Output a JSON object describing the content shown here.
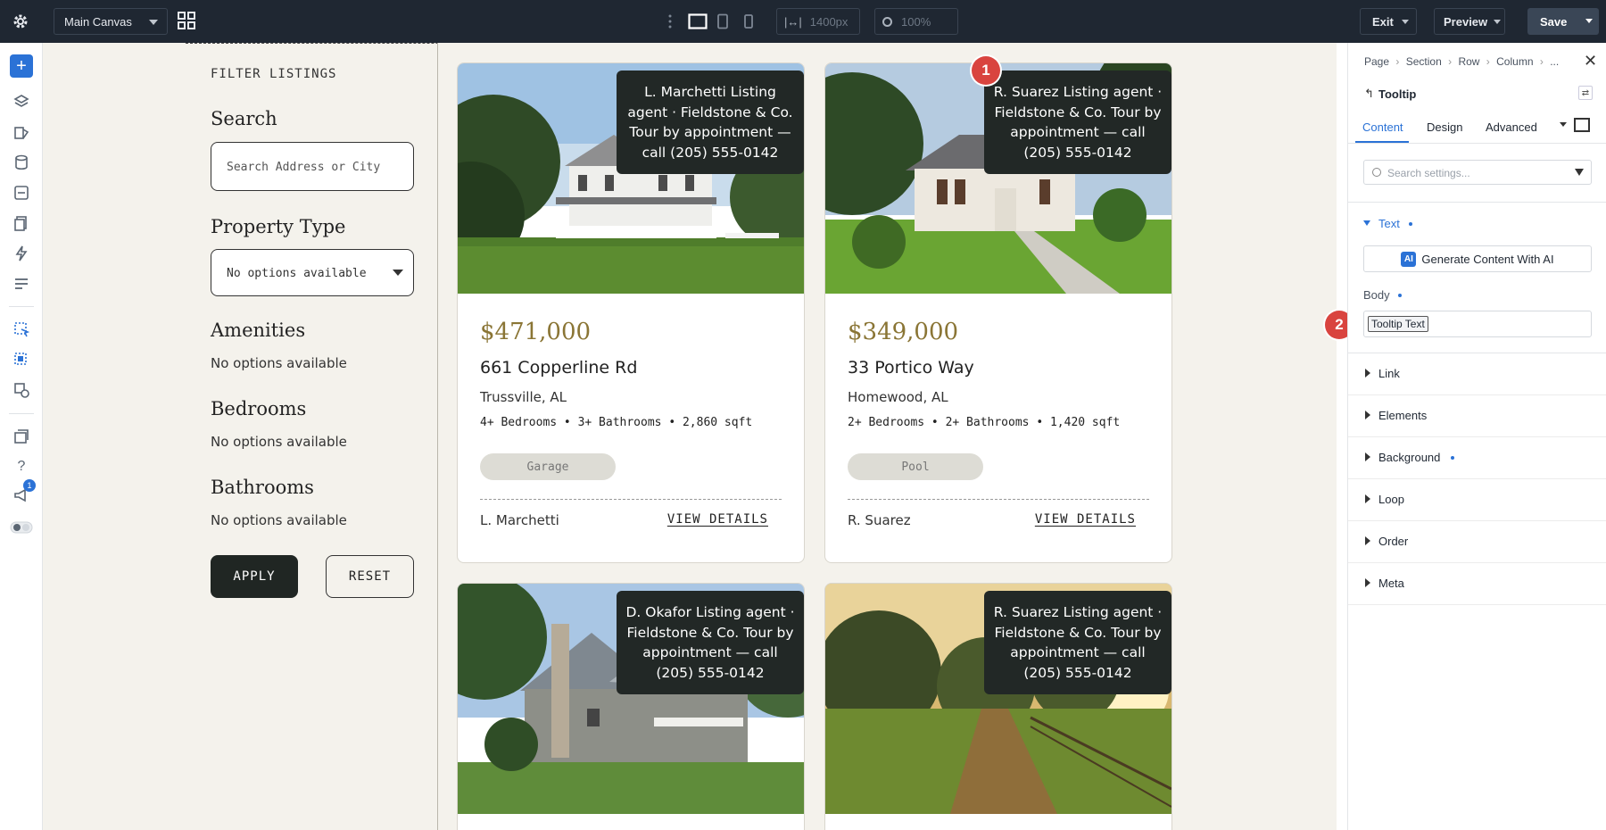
{
  "topbar": {
    "canvas_select": "Main Canvas",
    "width_value": "1400px",
    "zoom_value": "100%",
    "exit_label": "Exit",
    "preview_label": "Preview",
    "save_label": "Save"
  },
  "left_rail": {
    "notification_count": "1",
    "help_glyph": "?"
  },
  "filters": {
    "heading": "FILTER LISTINGS",
    "search_label": "Search",
    "search_placeholder": "Search Address or City",
    "property_type_label": "Property Type",
    "property_type_value": "No options available",
    "amenities_label": "Amenities",
    "amenities_value": "No options available",
    "bedrooms_label": "Bedrooms",
    "bedrooms_value": "No options available",
    "bathrooms_label": "Bathrooms",
    "bathrooms_value": "No options available",
    "apply_label": "APPLY",
    "reset_label": "RESET"
  },
  "listings": [
    {
      "tooltip": "L. Marchetti Listing agent · Fieldstone & Co. Tour by appointment — call (205) 555-0142",
      "price": "$471,000",
      "address": "661 Copperline Rd",
      "city": "Trussville, AL",
      "specs": "4+ Bedrooms • 3+ Bathrooms • 2,860 sqft",
      "amenity": "Garage",
      "agent": "L. Marchetti",
      "cta": "VIEW DETAILS"
    },
    {
      "tooltip": "R. Suarez Listing agent · Fieldstone & Co. Tour by appointment — call (205) 555-0142",
      "price": "$349,000",
      "address": "33 Portico Way",
      "city": "Homewood, AL",
      "specs": "2+ Bedrooms • 2+ Bathrooms • 1,420 sqft",
      "amenity": "Pool",
      "agent": "R. Suarez",
      "cta": "VIEW DETAILS"
    },
    {
      "tooltip": "D. Okafor Listing agent · Fieldstone & Co. Tour by appointment — call (205) 555-0142"
    },
    {
      "tooltip": "R. Suarez Listing agent · Fieldstone & Co. Tour by appointment — call (205) 555-0142"
    }
  ],
  "markers": {
    "one": "1",
    "two": "2"
  },
  "panel": {
    "breadcrumb": [
      "Page",
      "Section",
      "Row",
      "Column",
      "..."
    ],
    "element_name": "Tooltip",
    "tabs": [
      "Content",
      "Design",
      "Advanced"
    ],
    "search_placeholder": "Search settings...",
    "text_section": "Text",
    "ai_button": "Generate Content With AI",
    "ai_badge": "AI",
    "body_label": "Body",
    "body_value": "Tooltip Text",
    "sections": [
      "Link",
      "Elements",
      "Background",
      "Loop",
      "Order",
      "Meta"
    ]
  },
  "colors": {
    "accent": "#2b72d6",
    "topbar": "#1f2732",
    "price": "#8a7535",
    "marker": "#d9443f"
  }
}
